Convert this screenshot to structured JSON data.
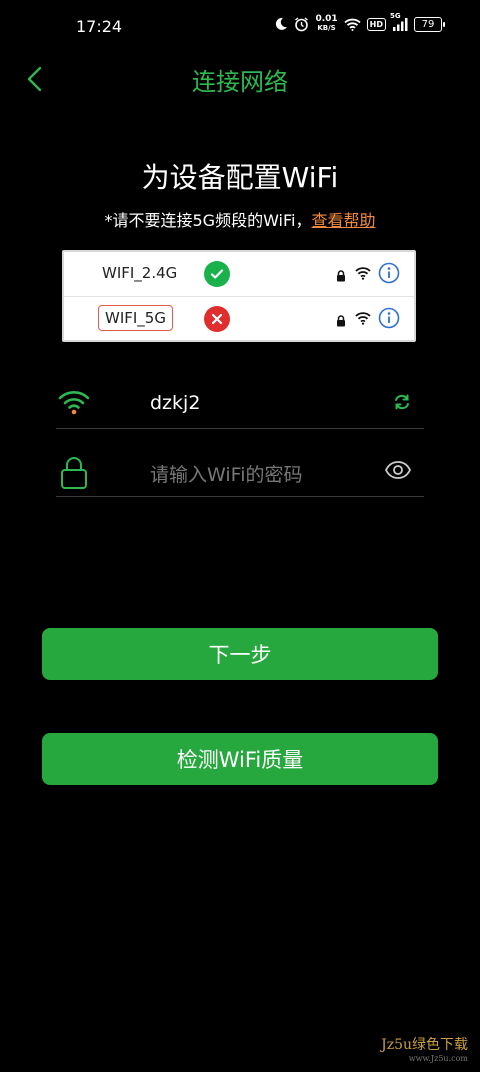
{
  "status_bar": {
    "time": "17:24",
    "net_speed_value": "0.01",
    "net_speed_unit": "KB/S",
    "hd_label": "HD",
    "signal_label": "5G",
    "battery": "79"
  },
  "header": {
    "title": "连接网络"
  },
  "main": {
    "heading": "为设备配置WiFi",
    "note_text": "*请不要连接5G频段的WiFi，",
    "help_link": "查看帮助"
  },
  "example_card": {
    "rows": [
      {
        "name": "WIFI_2.4G",
        "status": "ok"
      },
      {
        "name": "WIFI_5G",
        "status": "bad"
      }
    ]
  },
  "form": {
    "ssid_value": "dzkj2",
    "password_placeholder": "请输入WiFi的密码"
  },
  "buttons": {
    "next": "下一步",
    "check_quality": "检测WiFi质量"
  },
  "watermark": {
    "text": "Jz5u绿色下载",
    "sub": "www.Jz5u.com"
  },
  "colors": {
    "accent": "#2eb84f",
    "button": "#27a83e",
    "link": "#f08a3c",
    "ok": "#19b24a",
    "bad": "#e02d2d"
  }
}
